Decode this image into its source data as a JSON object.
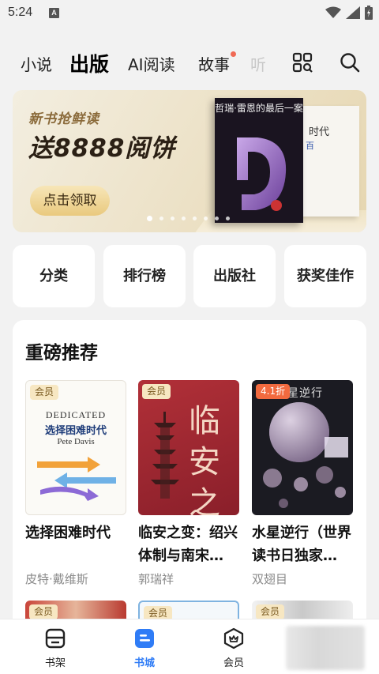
{
  "status_bar": {
    "time": "5:24",
    "notification_icon": "A"
  },
  "top_nav": {
    "tabs": [
      {
        "label": "小说",
        "state": "normal"
      },
      {
        "label": "出版",
        "state": "active"
      },
      {
        "label": "AI阅读",
        "state": "normal"
      },
      {
        "label": "故事",
        "state": "normal",
        "has_dot": true
      },
      {
        "label": "听",
        "state": "faded"
      }
    ],
    "icons": [
      "category-grid-icon",
      "search-icon"
    ],
    "dot_color": "#f06a55"
  },
  "banner": {
    "subtitle": "新书抢鲜读",
    "headline": "送8888阅饼",
    "button": "点击领取",
    "book_title": "哲瑞·雷恩的最后一案",
    "back_book_title": "时代",
    "back_book_sub": "百",
    "page_count": 8,
    "active_page": 0
  },
  "quick_entries": [
    "分类",
    "排行榜",
    "出版社",
    "获奖佳作"
  ],
  "recommend": {
    "title": "重磅推荐",
    "books": [
      {
        "badge": "会员",
        "badge_type": "member",
        "title": "选择困难时代",
        "author": "皮特·戴维斯",
        "cover_title": "选择困难时代",
        "cover_en": "DEDICATED",
        "cover_author": "Pete Davis"
      },
      {
        "badge": "会员",
        "badge_type": "member",
        "title": "临安之变：绍兴体制与南宋…",
        "author": "郭瑞祥",
        "cover_title": "临安之变"
      },
      {
        "badge": "4.1折",
        "badge_type": "discount",
        "title": "水星逆行（世界读书日独家…",
        "author": "双翅目",
        "cover_title": "水星逆行"
      }
    ],
    "row2_badges": [
      "会员",
      "会员",
      "会员"
    ]
  },
  "bottom_nav": {
    "items": [
      {
        "label": "书架",
        "icon": "bookshelf-icon",
        "active": false
      },
      {
        "label": "书城",
        "icon": "bookstore-icon",
        "active": true
      },
      {
        "label": "会员",
        "icon": "member-icon",
        "active": false
      }
    ],
    "accent": "#2f7cf6"
  }
}
